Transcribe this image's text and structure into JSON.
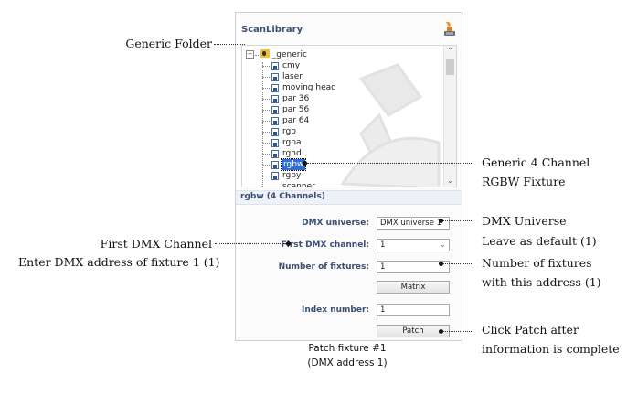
{
  "panel": {
    "title": "ScanLibrary",
    "info": "rgbw (4 Channels)"
  },
  "tree": {
    "root": "_generic",
    "items": [
      "cmy",
      "laser",
      "moving head",
      "par 36",
      "par 56",
      "par 64",
      "rgb",
      "rgba",
      "rghd",
      "rgbw",
      "rgby",
      "scanner"
    ],
    "selected": "rgbw"
  },
  "form": {
    "dmx_universe_label": "DMX universe:",
    "dmx_universe_value": "DMX universe 1",
    "first_channel_label": "First DMX channel:",
    "first_channel_value": "1",
    "num_fixtures_label": "Number of fixtures:",
    "num_fixtures_value": "1",
    "matrix_button": "Matrix",
    "index_label": "Index number:",
    "index_value": "1",
    "patch_button": "Patch"
  },
  "annotations": {
    "generic_folder": "Generic Folder",
    "generic_4ch_line1": "Generic 4 Channel",
    "generic_4ch_line2": "RGBW Fixture",
    "dmx_universe_line1": "DMX Universe",
    "dmx_universe_line2": "Leave as default (1)",
    "first_dmx_line1": "First DMX Channel",
    "first_dmx_line2": "Enter DMX address of fixture 1 (1)",
    "num_fixtures_line1": "Number of fixtures",
    "num_fixtures_line2": "with this address (1)",
    "patch_line1": "Click Patch after",
    "patch_line2": "information is complete"
  },
  "caption": {
    "line1": "Patch fixture #1",
    "line2": "(DMX address 1)"
  }
}
